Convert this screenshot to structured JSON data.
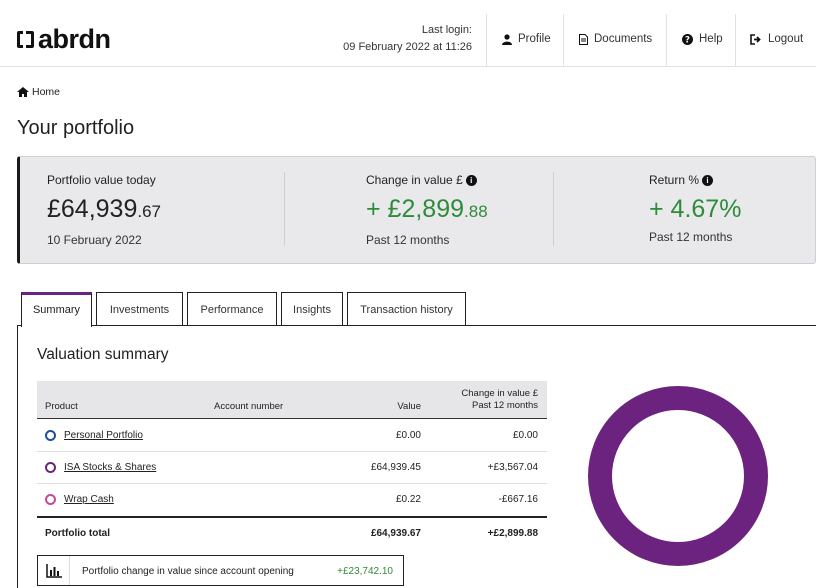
{
  "header": {
    "brand": "abrdn",
    "last_login_label": "Last login:",
    "last_login_value": "09 February 2022 at 11:26",
    "nav": [
      {
        "label": "Profile",
        "icon": "user-icon"
      },
      {
        "label": "Documents",
        "icon": "document-icon"
      },
      {
        "label": "Help",
        "icon": "question-icon"
      },
      {
        "label": "Logout",
        "icon": "logout-icon"
      }
    ]
  },
  "breadcrumb": {
    "home": "Home"
  },
  "page_title": "Your portfolio",
  "summary": {
    "value_today": {
      "label": "Portfolio value today",
      "main": "£64,939",
      "cents": ".67",
      "sub": "10 February 2022"
    },
    "change": {
      "label": "Change in value £",
      "main": "+ £2,899",
      "cents": ".88",
      "sub": "Past 12 months"
    },
    "return": {
      "label": "Return %",
      "main": "+ 4.67%",
      "sub": "Past 12 months"
    }
  },
  "tabs": [
    "Summary",
    "Investments",
    "Performance",
    "Insights",
    "Transaction history"
  ],
  "valuation": {
    "title": "Valuation summary",
    "columns": {
      "product": "Product",
      "account": "Account number",
      "value": "Value",
      "change_line1": "Change in value £",
      "change_line2": "Past 12 months"
    },
    "rows": [
      {
        "product": "Personal Portfolio",
        "value": "£0.00",
        "change": "£0.00",
        "ring_color": "#1f4e9e",
        "change_color": "#222222"
      },
      {
        "product": "ISA Stocks & Shares",
        "value": "£64,939.45",
        "change": "+£3,567.04",
        "ring_color": "#6c2380",
        "change_color": "#2e8b3a"
      },
      {
        "product": "Wrap Cash",
        "value": "£0.22",
        "change": "-£667.16",
        "ring_color": "#c8479e",
        "change_color": "#222222"
      }
    ],
    "total": {
      "label": "Portfolio total",
      "value": "£64,939.67",
      "change": "+£2,899.88"
    },
    "since_opening": {
      "label": "Portfolio change in value since account opening",
      "value": "+£23,742.10"
    }
  },
  "colors": {
    "brand_purple": "#6c2380",
    "positive_green": "#2e8b3a"
  }
}
